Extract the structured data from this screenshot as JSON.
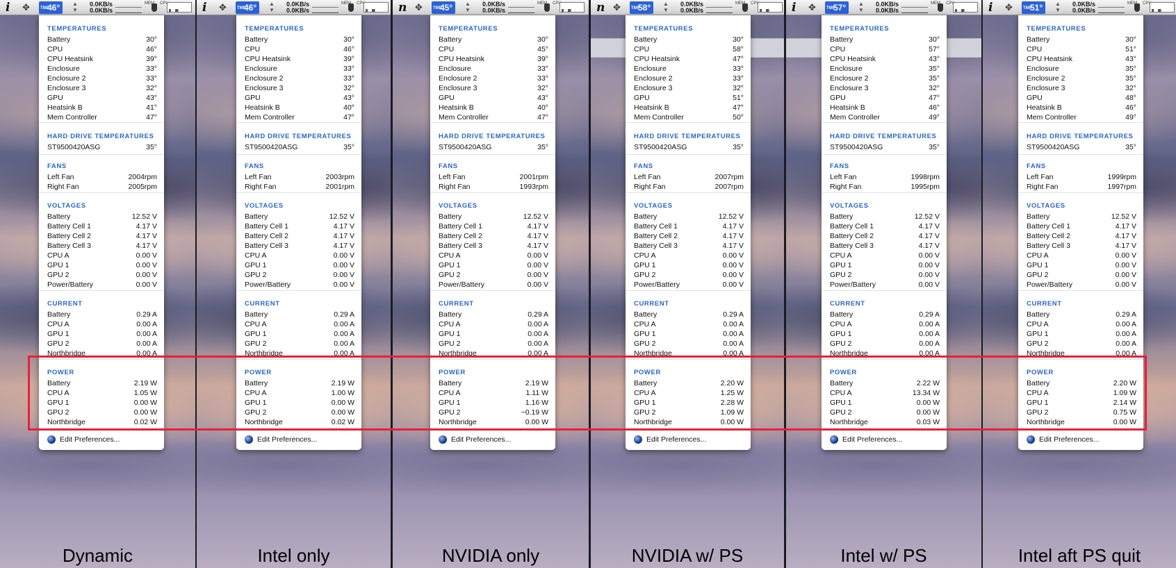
{
  "net": {
    "up": "0.0KB/s",
    "down": "0.0KB/s"
  },
  "labels": {
    "temperatures": "TEMPERATURES",
    "hdd": "HARD DRIVE TEMPERATURES",
    "fans": "FANS",
    "voltages": "VOLTAGES",
    "current": "CURRENT",
    "power": "POWER",
    "edit_prefs": "Edit Preferences...",
    "tmp": "TMP",
    "mem": "MEM",
    "cpu": "CPU"
  },
  "colors": {
    "accent": "#2c62d6",
    "section": "#2a66c4",
    "highlight": "#e8203a"
  },
  "icons": {
    "info": "i",
    "nvidia": "n",
    "move": "✥",
    "globe": "globe-icon"
  },
  "row_labels": {
    "temperatures": [
      "Battery",
      "CPU",
      "CPU Heatsink",
      "Enclosure",
      "Enclosure 2",
      "Enclosure 3",
      "GPU",
      "Heatsink B",
      "Mem Controller"
    ],
    "hdd": [
      "ST9500420ASG"
    ],
    "fans": [
      "Left Fan",
      "Right Fan"
    ],
    "voltages": [
      "Battery",
      "Battery Cell 1",
      "Battery Cell 2",
      "Battery Cell 3",
      "CPU A",
      "GPU 1",
      "GPU 2",
      "Power/Battery"
    ],
    "current": [
      "Battery",
      "CPU A",
      "GPU 1",
      "GPU 2",
      "Northbridge"
    ],
    "power": [
      "Battery",
      "CPU A",
      "GPU 1",
      "GPU 2",
      "Northbridge"
    ]
  },
  "panels": [
    {
      "caption": "Dynamic",
      "glyph": "i",
      "menubar_temp": "46°",
      "temperatures": [
        "30°",
        "46°",
        "39°",
        "33°",
        "33°",
        "32°",
        "43°",
        "41°",
        "47°"
      ],
      "hdd": [
        "35°"
      ],
      "fans": [
        "2004rpm",
        "2005rpm"
      ],
      "voltages": [
        "12.52 V",
        "4.17 V",
        "4.17 V",
        "4.17 V",
        "0.00 V",
        "0.00 V",
        "0.00 V",
        "0.00 V"
      ],
      "current": [
        "0.29 A",
        "0.00 A",
        "0.00 A",
        "0.00 A",
        "0.00 A"
      ],
      "power": [
        "2.19 W",
        "1.05 W",
        "0.00 W",
        "0.00 W",
        "0.02 W"
      ]
    },
    {
      "caption": "Intel only",
      "glyph": "i",
      "menubar_temp": "46°",
      "temperatures": [
        "30°",
        "46°",
        "39°",
        "33°",
        "33°",
        "32°",
        "43°",
        "40°",
        "47°"
      ],
      "hdd": [
        "35°"
      ],
      "fans": [
        "2003rpm",
        "2001rpm"
      ],
      "voltages": [
        "12.52 V",
        "4.17 V",
        "4.17 V",
        "4.17 V",
        "0.00 V",
        "0.00 V",
        "0.00 V",
        "0.00 V"
      ],
      "current": [
        "0.29 A",
        "0.00 A",
        "0.00 A",
        "0.00 A",
        "0.00 A"
      ],
      "power": [
        "2.19 W",
        "1.00 W",
        "0.00 W",
        "0.00 W",
        "0.02 W"
      ]
    },
    {
      "caption": "NVIDIA only",
      "glyph": "n",
      "menubar_temp": "45°",
      "temperatures": [
        "30°",
        "45°",
        "39°",
        "33°",
        "33°",
        "32°",
        "43°",
        "40°",
        "47°"
      ],
      "hdd": [
        "35°"
      ],
      "fans": [
        "2001rpm",
        "1993rpm"
      ],
      "voltages": [
        "12.52 V",
        "4.17 V",
        "4.17 V",
        "4.17 V",
        "0.00 V",
        "0.00 V",
        "0.00 V",
        "0.00 V"
      ],
      "current": [
        "0.29 A",
        "0.00 A",
        "0.00 A",
        "0.00 A",
        "0.00 A"
      ],
      "power": [
        "2.19 W",
        "1.11 W",
        "1.16 W",
        "−0.19 W",
        "0.00 W"
      ]
    },
    {
      "caption": "NVIDIA w/ PS",
      "glyph": "n",
      "menubar_temp": "58°",
      "temperatures": [
        "30°",
        "58°",
        "47°",
        "33°",
        "33°",
        "32°",
        "51°",
        "47°",
        "50°"
      ],
      "hdd": [
        "35°"
      ],
      "fans": [
        "2007rpm",
        "2007rpm"
      ],
      "voltages": [
        "12.52 V",
        "4.17 V",
        "4.17 V",
        "4.17 V",
        "0.00 V",
        "0.00 V",
        "0.00 V",
        "0.00 V"
      ],
      "current": [
        "0.29 A",
        "0.00 A",
        "0.00 A",
        "0.00 A",
        "0.00 A"
      ],
      "power": [
        "2.20 W",
        "1.25 W",
        "2.28 W",
        "1.09 W",
        "0.00 W"
      ]
    },
    {
      "caption": "Intel w/ PS",
      "glyph": "i",
      "menubar_temp": "57°",
      "temperatures": [
        "30°",
        "57°",
        "43°",
        "35°",
        "35°",
        "32°",
        "47°",
        "46°",
        "49°"
      ],
      "hdd": [
        "35°"
      ],
      "fans": [
        "1998rpm",
        "1995rpm"
      ],
      "voltages": [
        "12.52 V",
        "4.17 V",
        "4.17 V",
        "4.17 V",
        "0.00 V",
        "0.00 V",
        "0.00 V",
        "0.00 V"
      ],
      "current": [
        "0.29 A",
        "0.00 A",
        "0.00 A",
        "0.00 A",
        "0.00 A"
      ],
      "power": [
        "2.22 W",
        "13.34 W",
        "0.00 W",
        "0.00 W",
        "0.03 W"
      ]
    },
    {
      "caption": "Intel aft PS quit",
      "glyph": "i",
      "menubar_temp": "51°",
      "temperatures": [
        "30°",
        "51°",
        "43°",
        "35°",
        "35°",
        "32°",
        "48°",
        "46°",
        "49°"
      ],
      "hdd": [
        "35°"
      ],
      "fans": [
        "1999rpm",
        "1997rpm"
      ],
      "voltages": [
        "12.52 V",
        "4.17 V",
        "4.17 V",
        "4.17 V",
        "0.00 V",
        "0.00 V",
        "0.00 V",
        "0.00 V"
      ],
      "current": [
        "0.29 A",
        "0.00 A",
        "0.00 A",
        "0.00 A",
        "0.00 A"
      ],
      "power": [
        "2.20 W",
        "1.09 W",
        "2.14 W",
        "0.75 W",
        "0.00 W"
      ]
    }
  ]
}
